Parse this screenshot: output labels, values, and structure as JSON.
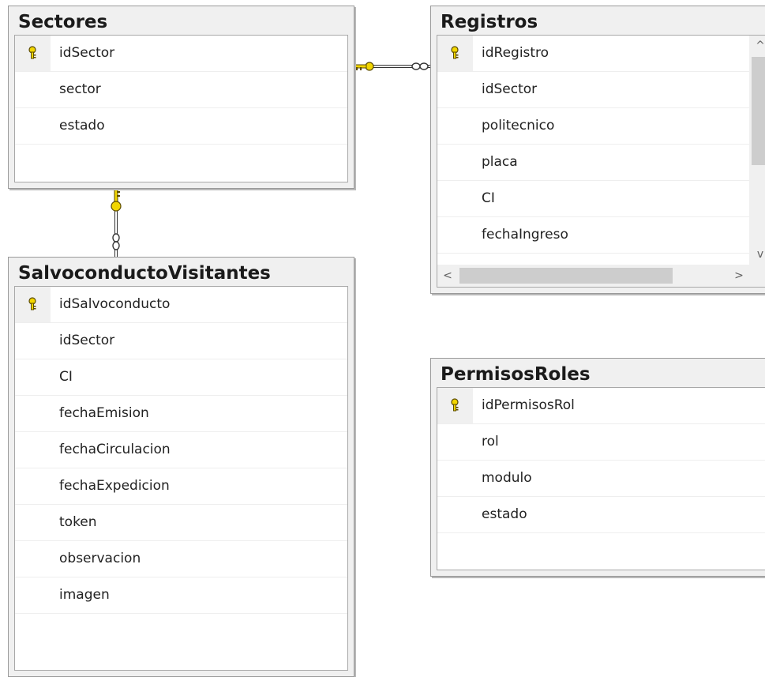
{
  "colors": {
    "key": "#f2d600",
    "key_outline": "#5a4a00",
    "connector": "#333333"
  },
  "icons": {
    "primary_key": "key-icon",
    "relationship_one": "key-icon",
    "relationship_many": "infinity-icon"
  },
  "tables": {
    "sectores": {
      "title": "Sectores",
      "columns": [
        {
          "name": "idSector",
          "primary_key": true
        },
        {
          "name": "sector",
          "primary_key": false
        },
        {
          "name": "estado",
          "primary_key": false
        }
      ]
    },
    "registros": {
      "title": "Registros",
      "columns": [
        {
          "name": "idRegistro",
          "primary_key": true
        },
        {
          "name": "idSector",
          "primary_key": false
        },
        {
          "name": "politecnico",
          "primary_key": false
        },
        {
          "name": "placa",
          "primary_key": false
        },
        {
          "name": "CI",
          "primary_key": false
        },
        {
          "name": "fechaIngreso",
          "primary_key": false
        }
      ],
      "scrollbars": {
        "vertical_arrows": [
          "^",
          "v"
        ],
        "horizontal_arrows": [
          "<",
          ">"
        ]
      }
    },
    "salvoconducto": {
      "title": "SalvoconductoVisitantes",
      "columns": [
        {
          "name": "idSalvoconducto",
          "primary_key": true
        },
        {
          "name": "idSector",
          "primary_key": false
        },
        {
          "name": "CI",
          "primary_key": false
        },
        {
          "name": "fechaEmision",
          "primary_key": false
        },
        {
          "name": "fechaCirculacion",
          "primary_key": false
        },
        {
          "name": "fechaExpedicion",
          "primary_key": false
        },
        {
          "name": "token",
          "primary_key": false
        },
        {
          "name": "observacion",
          "primary_key": false
        },
        {
          "name": "imagen",
          "primary_key": false
        }
      ]
    },
    "permisos": {
      "title": "PermisosRoles",
      "columns": [
        {
          "name": "idPermisosRol",
          "primary_key": true
        },
        {
          "name": "rol",
          "primary_key": false
        },
        {
          "name": "modulo",
          "primary_key": false
        },
        {
          "name": "estado",
          "primary_key": false
        }
      ]
    }
  },
  "relationships": [
    {
      "from": "Sectores",
      "to": "Registros",
      "one_end": "key",
      "many_end": "infinity"
    },
    {
      "from": "Sectores",
      "to": "SalvoconductoVisitantes",
      "one_end": "key",
      "many_end": "infinity"
    }
  ]
}
